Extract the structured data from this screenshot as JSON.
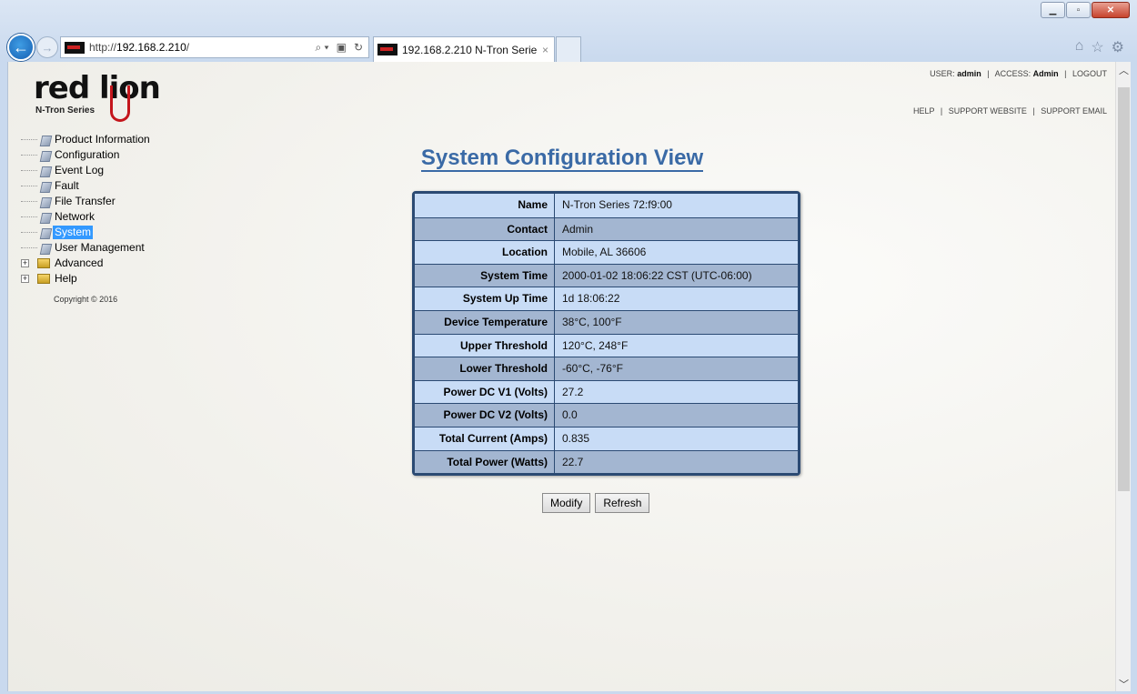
{
  "browser": {
    "url_prefix": "http://",
    "url_host": "192.168.2.210",
    "url_suffix": "/",
    "tab_title": "192.168.2.210 N-Tron Series...",
    "tab_close": "×",
    "window_controls": [
      "minimize",
      "maximize",
      "close"
    ]
  },
  "header": {
    "user_label": "USER:",
    "user_value": "admin",
    "access_label": "ACCESS:",
    "access_value": "Admin",
    "logout": "LOGOUT",
    "help": "HELP",
    "support_website": "SUPPORT WEBSITE",
    "support_email": "SUPPORT EMAIL",
    "separator": "|"
  },
  "logo": {
    "word": "red lion",
    "series": "N-Tron Series",
    "brand_color": "#c4161c"
  },
  "nav": {
    "items": [
      {
        "label": "Product Information"
      },
      {
        "label": "Configuration"
      },
      {
        "label": "Event Log"
      },
      {
        "label": "Fault"
      },
      {
        "label": "File Transfer"
      },
      {
        "label": "Network"
      },
      {
        "label": "System",
        "selected": true
      },
      {
        "label": "User Management"
      }
    ],
    "folders": [
      {
        "label": "Advanced",
        "expander": "+"
      },
      {
        "label": "Help",
        "expander": "+"
      }
    ],
    "copyright": "Copyright © 2016"
  },
  "main": {
    "title": "System Configuration View",
    "rows": [
      {
        "key": "Name",
        "value": "N-Tron Series 72:f9:00"
      },
      {
        "key": "Contact",
        "value": "Admin"
      },
      {
        "key": "Location",
        "value": "Mobile, AL 36606"
      },
      {
        "key": "System Time",
        "value": "2000-01-02 18:06:22 CST (UTC-06:00)"
      },
      {
        "key": "System Up Time",
        "value": "1d 18:06:22"
      },
      {
        "key": "Device Temperature",
        "value": "38°C, 100°F"
      },
      {
        "key": "Upper Threshold",
        "value": "120°C, 248°F"
      },
      {
        "key": "Lower Threshold",
        "value": "-60°C, -76°F"
      },
      {
        "key": "Power DC V1 (Volts)",
        "value": "27.2"
      },
      {
        "key": "Power DC V2 (Volts)",
        "value": "0.0"
      },
      {
        "key": "Total Current (Amps)",
        "value": "0.835"
      },
      {
        "key": "Total Power (Watts)",
        "value": "22.7"
      }
    ],
    "buttons": {
      "modify": "Modify",
      "refresh": "Refresh"
    },
    "accent_color": "#3a6aa6"
  }
}
